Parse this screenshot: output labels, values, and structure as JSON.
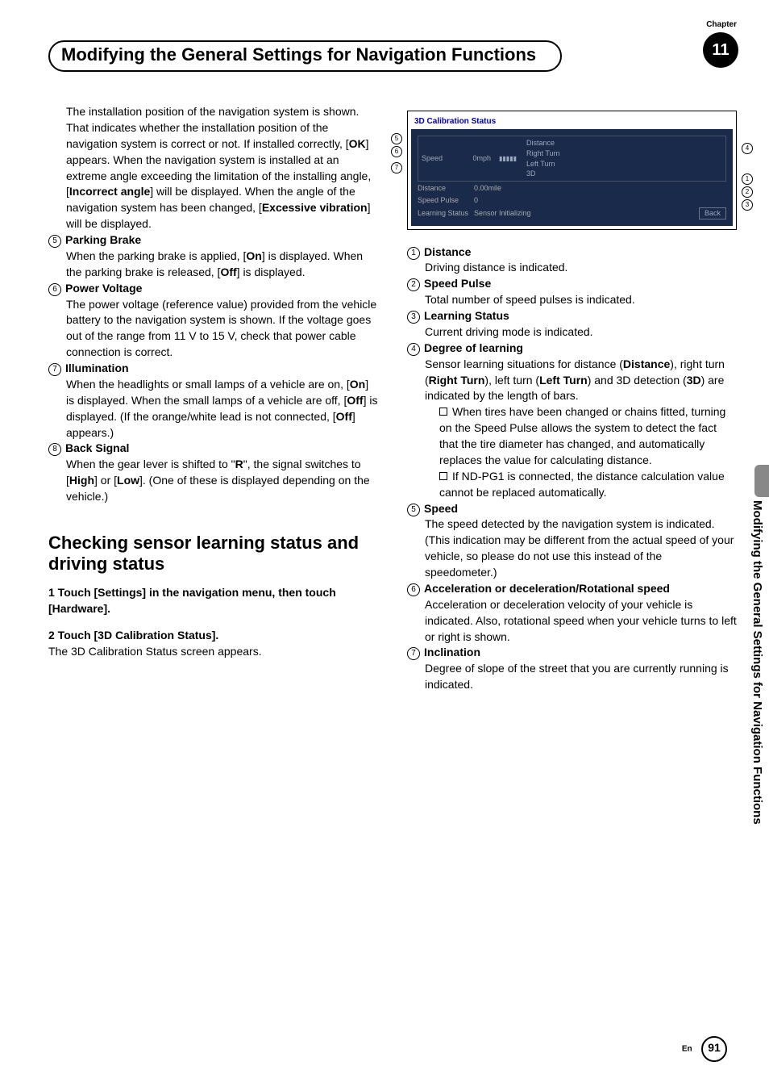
{
  "header": {
    "chapter_label": "Chapter",
    "chapter_number": "11",
    "title": "Modifying the General Settings for Navigation Functions"
  },
  "side_tab": "Modifying the General Settings for Navigation Functions",
  "left": {
    "p_install": "The installation position of the navigation system is shown. That indicates whether the installation position of the navigation system is correct or not. If installed correctly, [",
    "ok": "OK",
    "p_install2": "] appears. When the navigation system is installed at an extreme angle exceeding the limitation of the installing angle, [",
    "inc_angle": "Incorrect angle",
    "p_install3": "] will be displayed. When the angle of the navigation system has been changed, [",
    "exc_vib": "Excessive vibration",
    "p_install4": "] will be displayed.",
    "i5_t": "Parking Brake",
    "i5_body1": "When the parking brake is applied, [",
    "on": "On",
    "i5_body2": "] is displayed. When the parking brake is released, [",
    "off": "Off",
    "i5_body3": "] is displayed.",
    "i6_t": "Power Voltage",
    "i6_body": "The power voltage (reference value) provided from the vehicle battery to the navigation system is shown. If the voltage goes out of the range from 11 V to 15 V, check that power cable connection is correct.",
    "i7_t": "Illumination",
    "i7_b1": "When the headlights or small lamps of a vehicle are on, [",
    "i7_b2": "] is displayed. When the small lamps of a vehicle are off, [",
    "i7_b3": "] is displayed. (If the orange/white lead is not connected, [",
    "i7_b4": "] appears.)",
    "i8_t": "Back Signal",
    "i8_b1": "When the gear lever is shifted to \"",
    "R": "R",
    "i8_b2": "\", the signal switches to [",
    "High": "High",
    "i8_b3": "] or [",
    "Low": "Low",
    "i8_b4": "]. (One of these is displayed depending on the vehicle.)",
    "h2": "Checking sensor learning status and driving status",
    "s1": "1    Touch [Settings] in the navigation menu, then touch [Hardware].",
    "s2": "2    Touch [3D Calibration Status].",
    "s2b": "The 3D Calibration Status screen appears."
  },
  "figure": {
    "title": "3D Calibration Status",
    "speed": "Speed",
    "speed_v": "0mph",
    "dist_l": "Distance",
    "rt": "Right Turn",
    "lt": "Left Turn",
    "td": "3D",
    "distance": "Distance",
    "distance_v": "0.00mile",
    "sp": "Speed Pulse",
    "sp_v": "0",
    "ls": "Learning Status",
    "ls_v": "Sensor Initializing",
    "back": "Back"
  },
  "right": {
    "i1_t": "Distance",
    "i1_b": "Driving distance is indicated.",
    "i2_t": "Speed Pulse",
    "i2_b": "Total number of speed pulses is indicated.",
    "i3_t": "Learning Status",
    "i3_b": "Current driving mode is indicated.",
    "i4_t": "Degree of learning",
    "i4_b1": "Sensor learning situations for distance (",
    "d": "Distance",
    "i4_b2": "), right turn (",
    "rt": "Right Turn",
    "i4_b3": "), left turn (",
    "lt": "Left Turn",
    "i4_b4": ") and 3D detection (",
    "td": "3D",
    "i4_b5": ") are indicated by the length of bars.",
    "bul1": "When tires have been changed or chains fitted, turning on the Speed Pulse allows the system to detect the fact that the tire diameter has changed, and automatically replaces the value for calculating distance.",
    "bul2": "If ND-PG1 is connected, the distance calculation value cannot be replaced automatically.",
    "i5_t": "Speed",
    "i5_b": "The speed detected by the navigation system is indicated. (This indication may be different from the actual speed of your vehicle, so please do not use this instead of the speedometer.)",
    "i6_t": "Acceleration or deceleration/Rotational speed",
    "i6_b": "Acceleration or deceleration velocity of your vehicle is indicated. Also, rotational speed when your vehicle turns to left or right is shown.",
    "i7_t": "Inclination",
    "i7_b": "Degree of slope of the street that you are currently running is indicated."
  },
  "footer": {
    "en": "En",
    "pn": "91"
  },
  "n": {
    "1": "1",
    "2": "2",
    "3": "3",
    "4": "4",
    "5": "5",
    "6": "6",
    "7": "7",
    "8": "8"
  }
}
